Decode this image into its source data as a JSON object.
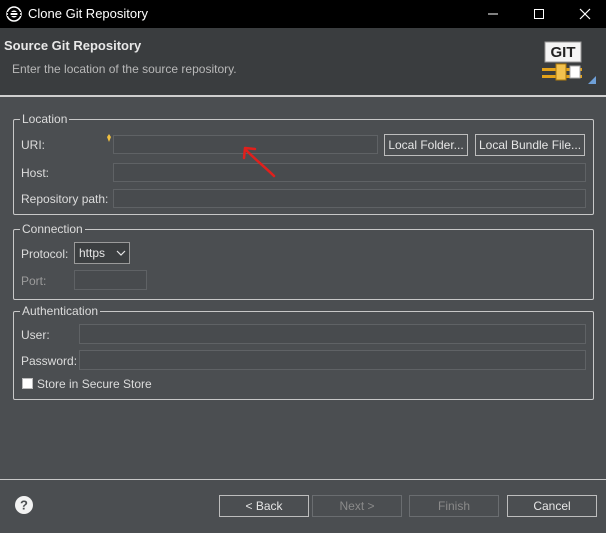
{
  "window": {
    "title": "Clone Git Repository",
    "controls": [
      "minimize",
      "maximize",
      "close"
    ]
  },
  "header": {
    "title": "Source Git Repository",
    "description": "Enter the location of the source repository.",
    "logo_text": "GIT"
  },
  "location": {
    "group_label": "Location",
    "uri_label": "URI:",
    "uri_value": "",
    "local_folder_button": "Local Folder...",
    "local_bundle_button": "Local Bundle File...",
    "host_label": "Host:",
    "host_value": "",
    "repo_path_label": "Repository path:",
    "repo_path_value": ""
  },
  "connection": {
    "group_label": "Connection",
    "protocol_label": "Protocol:",
    "protocol_value": "https",
    "port_label": "Port:",
    "port_value": ""
  },
  "authentication": {
    "group_label": "Authentication",
    "user_label": "User:",
    "user_value": "",
    "password_label": "Password:",
    "password_value": "",
    "store_label": "Store in Secure Store",
    "store_checked": false
  },
  "footer": {
    "back_label": "< Back",
    "next_label": "Next >",
    "finish_label": "Finish",
    "cancel_label": "Cancel"
  },
  "colors": {
    "annotation_arrow": "#e0201c",
    "background": "#4b4e51"
  }
}
